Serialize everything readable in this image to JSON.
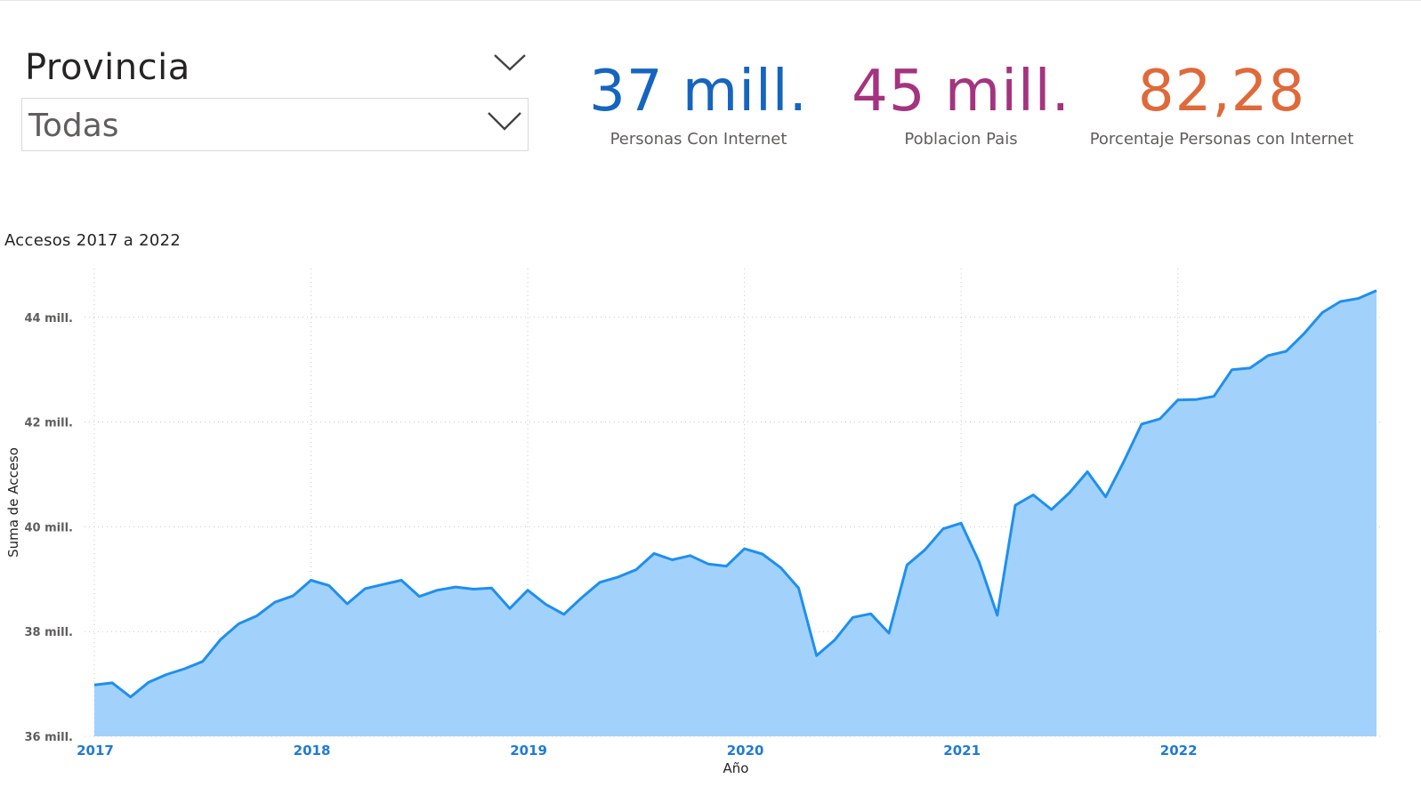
{
  "slicer": {
    "title": "Provincia",
    "selected": "Todas"
  },
  "kpis": [
    {
      "value": "37 mill.",
      "label": "Personas Con Internet",
      "color": "#1565c0"
    },
    {
      "value": "45 mill.",
      "label": "Poblacion Pais",
      "color": "#a4347f"
    },
    {
      "value": "82,28",
      "label": "Porcentaje Personas con Internet",
      "color": "#e0693a"
    }
  ],
  "chart_data": {
    "type": "area",
    "title": "Accesos 2017 a 2022",
    "xlabel": "Año",
    "ylabel": "Suma de Acceso",
    "x_range": [
      2017.0,
      2022.917
    ],
    "ylim": [
      36000000,
      44930000
    ],
    "yticks": [
      {
        "value": 36000000,
        "label": "36 mill."
      },
      {
        "value": 38000000,
        "label": "38 mill."
      },
      {
        "value": 40000000,
        "label": "40 mill."
      },
      {
        "value": 42000000,
        "label": "42 mill."
      },
      {
        "value": 44000000,
        "label": "44 mill."
      }
    ],
    "xticks": [
      {
        "value": 2017,
        "label": "2017"
      },
      {
        "value": 2018,
        "label": "2018"
      },
      {
        "value": 2019,
        "label": "2019"
      },
      {
        "value": 2020,
        "label": "2020"
      },
      {
        "value": 2021,
        "label": "2021"
      },
      {
        "value": 2022,
        "label": "2022"
      }
    ],
    "grid": true,
    "line_color": "#1e8ff0",
    "fill_color": "#a2d2fc",
    "series": [
      {
        "x": [
          2017.0,
          2017.083,
          2017.167,
          2017.25,
          2017.333,
          2017.417,
          2017.5,
          2017.583,
          2017.667,
          2017.75,
          2017.833,
          2017.917,
          2018.0,
          2018.083,
          2018.167,
          2018.25,
          2018.333,
          2018.417,
          2018.5,
          2018.583,
          2018.667,
          2018.75,
          2018.833,
          2018.917,
          2019.0,
          2019.083,
          2019.167,
          2019.25,
          2019.333,
          2019.417,
          2019.5,
          2019.583,
          2019.667,
          2019.75,
          2019.833,
          2019.917,
          2020.0,
          2020.083,
          2020.167,
          2020.25,
          2020.333,
          2020.417,
          2020.5,
          2020.583,
          2020.667,
          2020.75,
          2020.833,
          2020.917,
          2021.0,
          2021.083,
          2021.167,
          2021.25,
          2021.333,
          2021.417,
          2021.5,
          2021.583,
          2021.667,
          2021.75,
          2021.833,
          2021.917,
          2022.0,
          2022.083,
          2022.167,
          2022.25,
          2022.333,
          2022.417,
          2022.5,
          2022.583,
          2022.667,
          2022.75,
          2022.833,
          2022.917
        ],
        "y": [
          36980000,
          37020000,
          36750000,
          37030000,
          37180000,
          37290000,
          37430000,
          37850000,
          38150000,
          38300000,
          38560000,
          38680000,
          38980000,
          38880000,
          38530000,
          38820000,
          38900000,
          38980000,
          38670000,
          38790000,
          38850000,
          38810000,
          38830000,
          38440000,
          38790000,
          38520000,
          38330000,
          38650000,
          38940000,
          39040000,
          39180000,
          39490000,
          39370000,
          39450000,
          39290000,
          39250000,
          39580000,
          39480000,
          39220000,
          38830000,
          37540000,
          37840000,
          38270000,
          38340000,
          37970000,
          39270000,
          39560000,
          39960000,
          40070000,
          39330000,
          38310000,
          40410000,
          40610000,
          40330000,
          40650000,
          41050000,
          40570000,
          41240000,
          41960000,
          42060000,
          42420000,
          42430000,
          42490000,
          43000000,
          43030000,
          43270000,
          43350000,
          43690000,
          44090000,
          44300000,
          44360000,
          44510000
        ]
      }
    ]
  }
}
